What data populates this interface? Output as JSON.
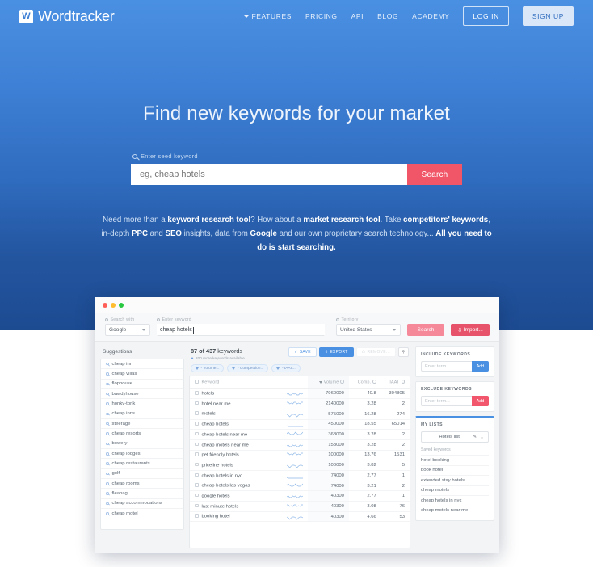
{
  "nav": {
    "brand_mark": "W",
    "brand_name": "Wordtracker",
    "links": [
      {
        "label": "FEATURES",
        "caret": true
      },
      {
        "label": "PRICING",
        "caret": false
      },
      {
        "label": "API",
        "caret": false
      },
      {
        "label": "BLOG",
        "caret": false
      },
      {
        "label": "ACADEMY",
        "caret": false
      }
    ],
    "login_label": "LOG IN",
    "signup_label": "SIGN UP"
  },
  "hero": {
    "title": "Find new keywords for your market",
    "seed_label": "Enter seed keyword",
    "seed_placeholder": "eg, cheap hotels",
    "seed_value": "",
    "search_button": "Search",
    "blurb_parts": [
      {
        "t": "Need more than a ",
        "b": false
      },
      {
        "t": "keyword research tool",
        "b": true
      },
      {
        "t": "? How about a ",
        "b": false
      },
      {
        "t": "market research tool",
        "b": true
      },
      {
        "t": ". Take ",
        "b": false
      },
      {
        "t": "competitors' keywords",
        "b": true
      },
      {
        "t": ", in-depth ",
        "b": false
      },
      {
        "t": "PPC",
        "b": true
      },
      {
        "t": " and ",
        "b": false
      },
      {
        "t": "SEO",
        "b": true
      },
      {
        "t": " insights, data from ",
        "b": false
      },
      {
        "t": "Google",
        "b": true
      },
      {
        "t": " and our own proprietary search technology... ",
        "b": false
      },
      {
        "t": "All you need to do is start searching.",
        "b": true
      }
    ]
  },
  "app": {
    "toolbar": {
      "search_with_label": "Search with",
      "search_with_value": "Google",
      "keyword_label": "Enter keyword",
      "keyword_value": "cheap hotels",
      "territory_label": "Territory",
      "territory_value": "United States",
      "search_button": "Search",
      "import_button": "Import..."
    },
    "suggestions": {
      "title": "Suggestions",
      "items": [
        "cheap inn",
        "cheap villas",
        "flophouse",
        "bawdyhouse",
        "honky-tonk",
        "cheap inns",
        "steerage",
        "cheap resorts",
        "bowery",
        "cheap lodges",
        "cheap restaurants",
        "golf",
        "cheap rooms",
        "fleabag",
        "cheap accommodations",
        "cheap motel"
      ]
    },
    "results": {
      "count_bold": "87 of 437",
      "count_rest": " keywords",
      "subtitle": "200 more keywords available...",
      "actions": {
        "save": "SAVE",
        "export": "EXPORT",
        "remove": "REMOVE...",
        "key_icon": "key-icon"
      },
      "filters": [
        "- Volume...",
        "- Competition...",
        "- IAAT..."
      ],
      "columns": [
        "Keyword",
        "Volume",
        "Comp.",
        "IAAT"
      ],
      "rows": [
        {
          "keyword": "hotels",
          "volume": "7960000",
          "comp": "40.8",
          "iaat": "304805"
        },
        {
          "keyword": "hotel near me",
          "volume": "2140000",
          "comp": "3.28",
          "iaat": "2"
        },
        {
          "keyword": "motels",
          "volume": "575000",
          "comp": "16.28",
          "iaat": "274"
        },
        {
          "keyword": "cheap hotels",
          "volume": "450000",
          "comp": "18.55",
          "iaat": "65014"
        },
        {
          "keyword": "cheap hotels near me",
          "volume": "368000",
          "comp": "3.28",
          "iaat": "2"
        },
        {
          "keyword": "cheap motels near me",
          "volume": "153000",
          "comp": "3.28",
          "iaat": "2"
        },
        {
          "keyword": "pet friendly hotels",
          "volume": "100000",
          "comp": "13.76",
          "iaat": "1531"
        },
        {
          "keyword": "priceline hotels",
          "volume": "100000",
          "comp": "3.82",
          "iaat": "5"
        },
        {
          "keyword": "cheap hotels in nyc",
          "volume": "74000",
          "comp": "2.77",
          "iaat": "1"
        },
        {
          "keyword": "cheap hotels las vegas",
          "volume": "74000",
          "comp": "3.21",
          "iaat": "2"
        },
        {
          "keyword": "google hotels",
          "volume": "40300",
          "comp": "2.77",
          "iaat": "1"
        },
        {
          "keyword": "last minute hotels",
          "volume": "40300",
          "comp": "3.08",
          "iaat": "76"
        },
        {
          "keyword": "booking hotel",
          "volume": "40300",
          "comp": "4.66",
          "iaat": "53"
        }
      ]
    },
    "include_panel": {
      "title": "INCLUDE KEYWORDS",
      "placeholder": "Enter term...",
      "add": "Add"
    },
    "exclude_panel": {
      "title": "EXCLUDE KEYWORDS",
      "placeholder": "Enter term...",
      "add": "Add"
    },
    "lists_panel": {
      "title": "MY LISTS",
      "selected_list": "Hotels list",
      "saved_label": "Saved keywords",
      "saved": [
        "hotel booking",
        "book hotel",
        "extended stay hotels",
        "cheap motels",
        "cheap hotels in nyc",
        "cheap motels near me"
      ]
    }
  },
  "colors": {
    "brand_blue": "#4a90e2",
    "deep_blue": "#1d4b92",
    "accent_red": "#f15668",
    "app_blue": "#4a90e2"
  }
}
